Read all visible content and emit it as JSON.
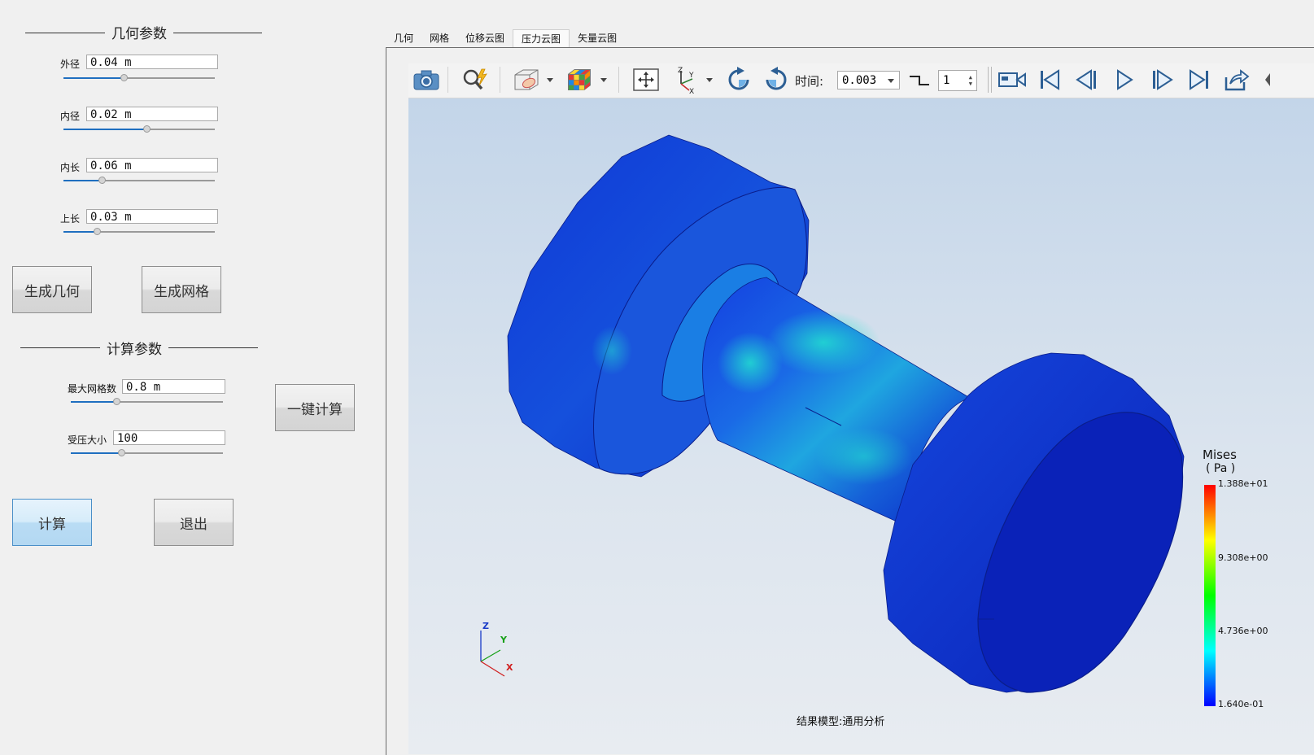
{
  "geometry": {
    "title": "几何参数",
    "params": [
      {
        "label": "外径",
        "value": "0.04 m",
        "level": 0.4
      },
      {
        "label": "内径",
        "value": "0.02 m",
        "level": 0.55
      },
      {
        "label": "内长",
        "value": "0.06 m",
        "level": 0.25
      },
      {
        "label": "上长",
        "value": "0.03 m",
        "level": 0.22
      }
    ],
    "generate_geometry_button": "生成几何",
    "generate_mesh_button": "生成网格"
  },
  "calculation": {
    "title": "计算参数",
    "max_mesh": {
      "label": "最大网格数",
      "value": "0.8 m",
      "level": 0.3
    },
    "pressure": {
      "label": "受压大小",
      "value": "100",
      "level": 0.33
    },
    "one_click_button": "一键计算",
    "compute_button": "计算",
    "exit_button": "退出"
  },
  "tabs": [
    "几何",
    "网格",
    "位移云图",
    "压力云图",
    "矢量云图"
  ],
  "active_tab_index": 3,
  "toolbar": {
    "time_label": "时间:",
    "time_value": "0.003",
    "step_value": "1"
  },
  "icons": {
    "screenshot": "camera-icon",
    "zoom": "magnifier-icon",
    "display": "box-display-icon",
    "colormap": "rubiks-cube-icon",
    "fit": "fit-view-icon",
    "axes": "axes-icon",
    "rotate_cw": "rotate-cw-icon",
    "rotate_ccw": "rotate-ccw-icon",
    "record": "video-camera-icon",
    "first": "first-frame-icon",
    "prev": "prev-frame-icon",
    "play": "play-icon",
    "next": "next-frame-icon",
    "last": "last-frame-icon",
    "export": "export-icon"
  },
  "legend": {
    "title": "Mises",
    "unit": "( Pa )",
    "ticks": [
      "1.388e+01",
      "9.308e+00",
      "4.736e+00",
      "1.640e-01"
    ],
    "colors": [
      "#ff0000",
      "#ffff00",
      "#00ff00",
      "#00ffff",
      "#0000ff"
    ]
  },
  "axes": {
    "x": "X",
    "y": "Y",
    "z": "Z"
  },
  "status": "结果模型:通用分析"
}
